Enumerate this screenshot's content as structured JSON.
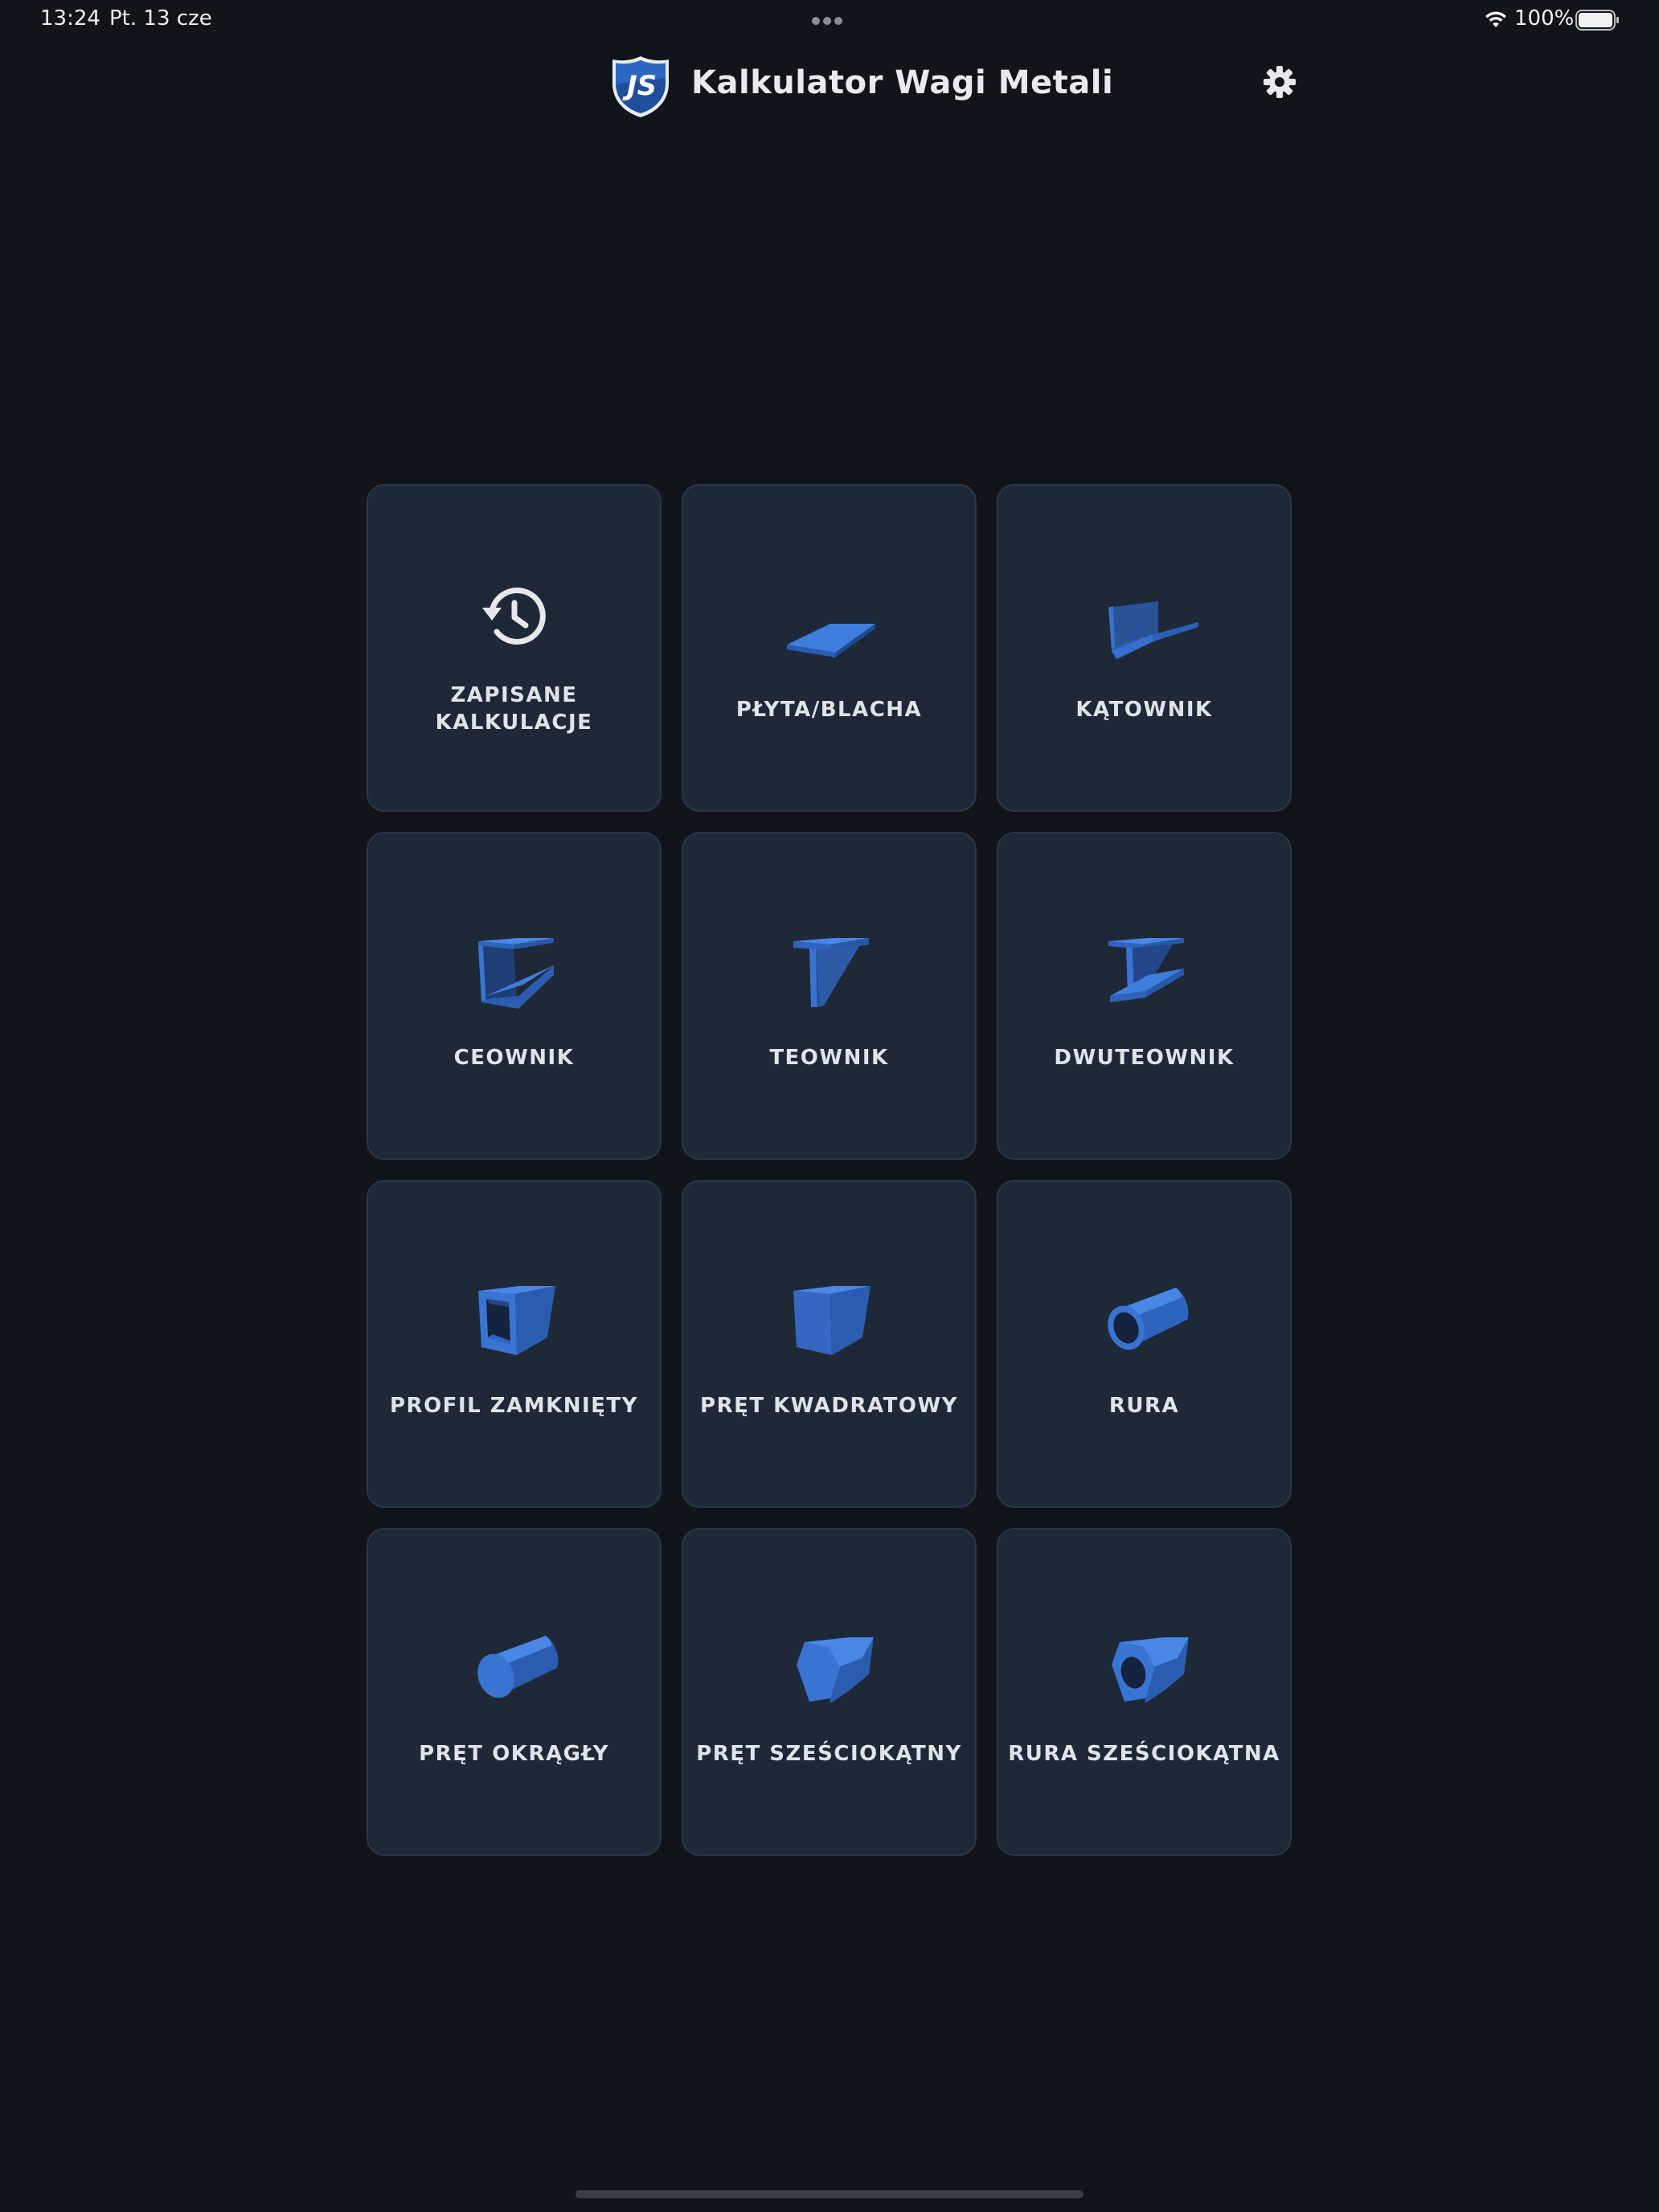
{
  "status_bar": {
    "time": "13:24",
    "date": "Pt. 13 cze",
    "battery": "100%",
    "icons": [
      "more-dots-icon",
      "wifi-icon",
      "battery-icon"
    ]
  },
  "header": {
    "title": "Kalkulator Wagi Metali",
    "logo_icon": "js-shield-logo",
    "settings_icon": "gear-icon"
  },
  "colors": {
    "background": "#111418",
    "tile_background": "#1e2836",
    "tile_border": "#2c3646",
    "accent_blue": "#3a78d8",
    "text": "#dfe3ea"
  },
  "tiles": [
    {
      "label": "ZAPISANE KALKULACJE",
      "icon": "history-icon"
    },
    {
      "label": "PŁYTA/BLACHA",
      "icon": "plate-icon"
    },
    {
      "label": "KĄTOWNIK",
      "icon": "angle-icon"
    },
    {
      "label": "CEOWNIK",
      "icon": "channel-icon"
    },
    {
      "label": "TEOWNIK",
      "icon": "tee-icon"
    },
    {
      "label": "DWUTEOWNIK",
      "icon": "i-beam-icon"
    },
    {
      "label": "PROFIL ZAMKNIĘTY",
      "icon": "hollow-section-icon"
    },
    {
      "label": "PRĘT KWADRATOWY",
      "icon": "square-bar-icon"
    },
    {
      "label": "RURA",
      "icon": "pipe-icon"
    },
    {
      "label": "PRĘT OKRĄGŁY",
      "icon": "round-bar-icon"
    },
    {
      "label": "PRĘT SZEŚCIOKĄTNY",
      "icon": "hex-bar-icon"
    },
    {
      "label": "RURA SZEŚCIOKĄTNA",
      "icon": "hex-pipe-icon"
    }
  ],
  "tile_label_lines": {
    "saved_line1": "ZAPISANE",
    "saved_line2": "KALKULACJE"
  }
}
